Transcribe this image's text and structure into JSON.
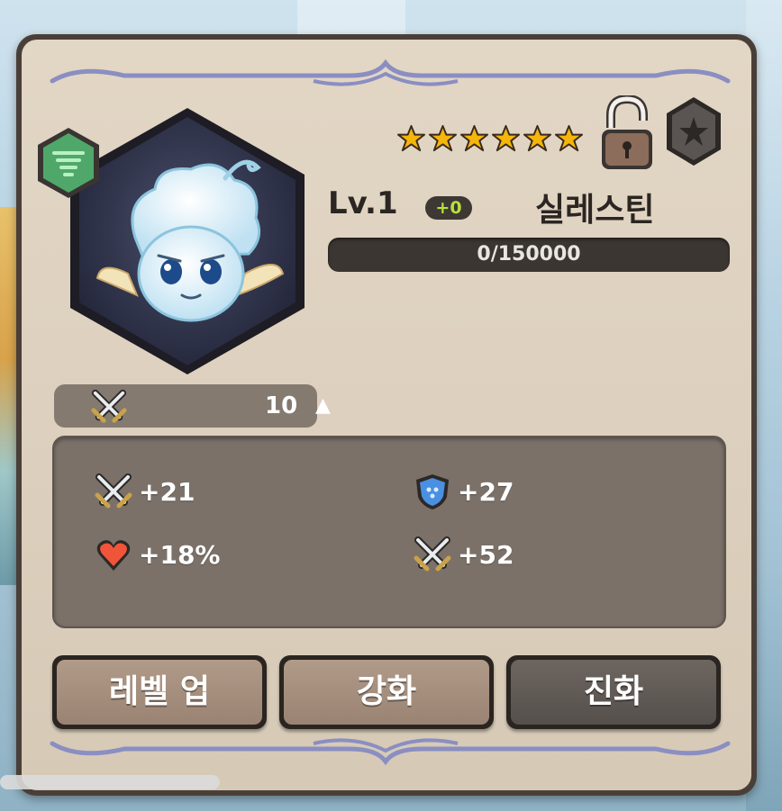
{
  "character": {
    "level_label": "Lv.1",
    "level_bonus": "+0",
    "name": "실레스틴",
    "stars": 6,
    "element_icon": "wind-element-icon",
    "lock_icon": "unlocked-padlock-icon",
    "rank_icon": "rank-star-badge-icon"
  },
  "experience": {
    "text": "0/150000",
    "progress": 0
  },
  "power": {
    "icon": "crossed-swords-icon",
    "value": "10",
    "arrow": "▲"
  },
  "stats": [
    {
      "icon": "crossed-swords-icon",
      "value": "+21"
    },
    {
      "icon": "blue-shield-icon",
      "value": "+27"
    },
    {
      "icon": "heart-icon",
      "value": "+18%"
    },
    {
      "icon": "crossed-swords-icon",
      "value": "+52"
    }
  ],
  "buttons": {
    "level_up": "레벨 업",
    "enhance": "강화",
    "evolve": "진화"
  },
  "colors": {
    "panel_bg": "#ddd0be",
    "stats_bg": "#7b7169",
    "button_brown": "#a38c7b",
    "button_dark": "#605a56",
    "level_bonus_green": "#b8e13c",
    "star_gold": "#f5b50a"
  }
}
